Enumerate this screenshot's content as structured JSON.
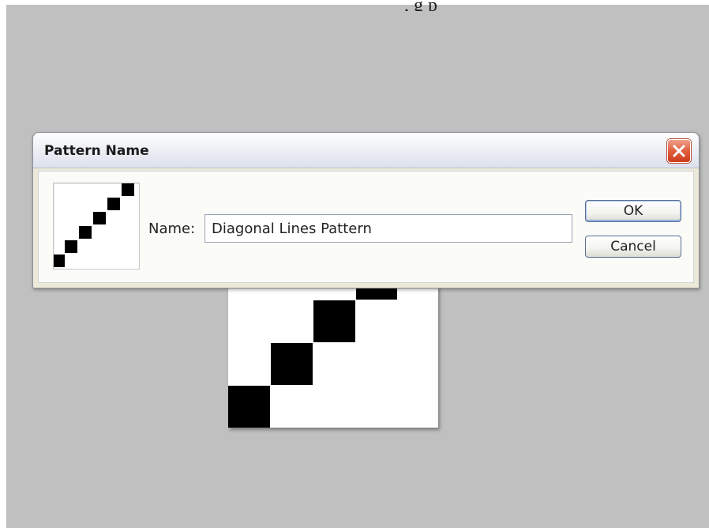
{
  "page": {
    "top_caption": ", g p"
  },
  "dialog": {
    "title": "Pattern Name",
    "close_icon": "close-x",
    "name_label": "Name:",
    "name_value": "Diagonal Lines Pattern",
    "ok_label": "OK",
    "cancel_label": "Cancel"
  },
  "colors": {
    "canvas_gray": "#c0c0c0",
    "dialog_bg": "#ece9d8",
    "close_red": "#e0603f",
    "pattern_black": "#000000"
  }
}
